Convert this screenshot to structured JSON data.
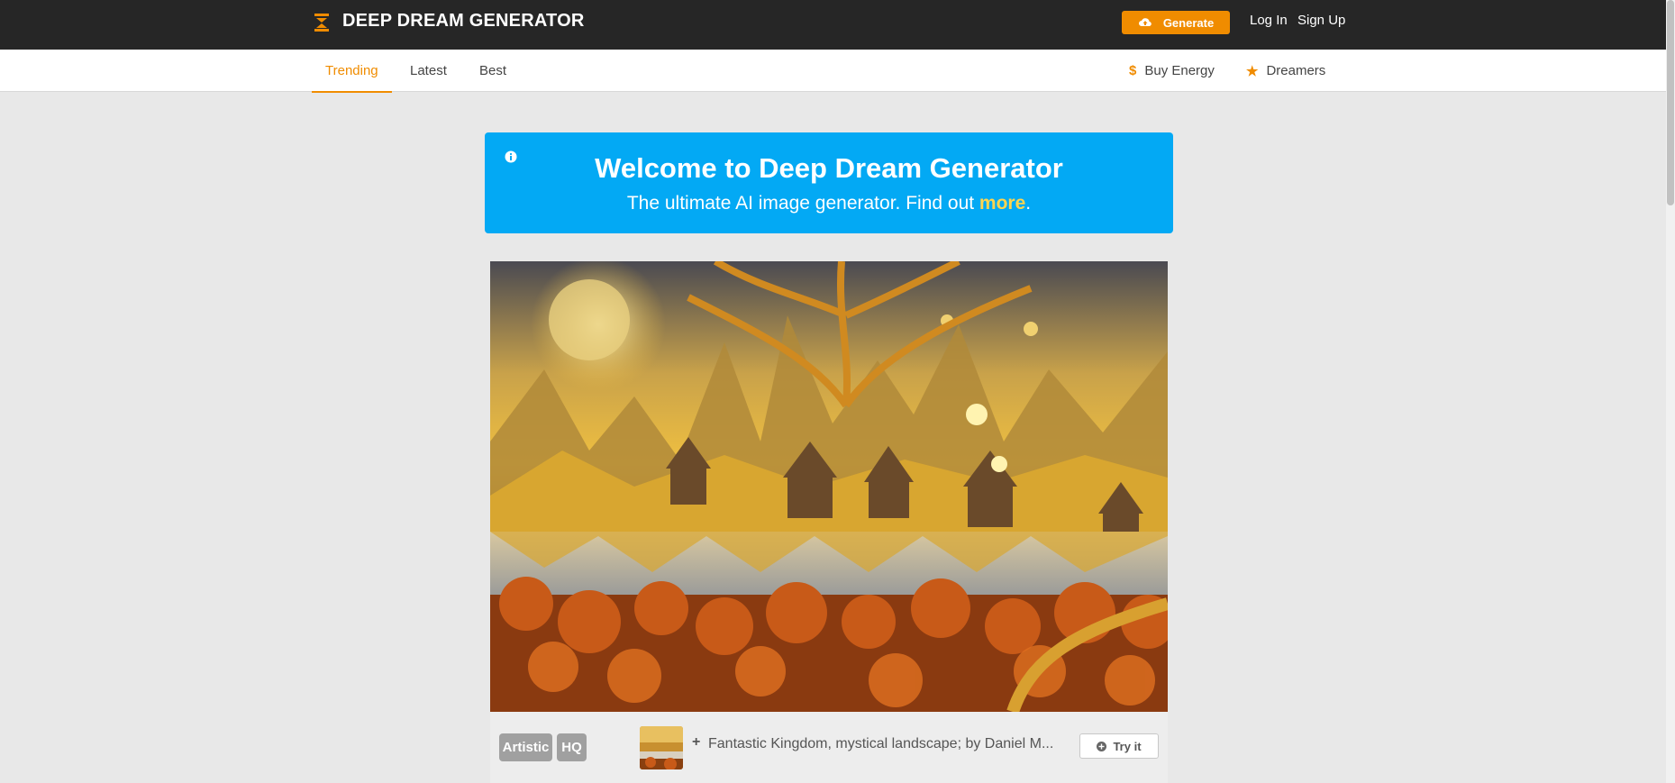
{
  "header": {
    "logo_text": "DEEP DREAM GENERATOR",
    "logo_icon": "hourglass-logo-icon",
    "generate_label": "Generate",
    "generate_icon": "cloud-upload-icon",
    "login_label": "Log In",
    "signup_label": "Sign Up",
    "accent_color": "#f08c00"
  },
  "subnav": {
    "tabs": [
      {
        "label": "Trending",
        "active": true
      },
      {
        "label": "Latest",
        "active": false
      },
      {
        "label": "Best",
        "active": false
      }
    ],
    "buy_energy": {
      "icon": "dollar-icon",
      "icon_glyph": "$",
      "label": "Buy Energy"
    },
    "dreamers": {
      "icon": "star-icon",
      "icon_glyph": "★",
      "label": "Dreamers"
    }
  },
  "welcome": {
    "icon": "info-icon",
    "title": "Welcome to Deep Dream Generator",
    "subtitle_prefix": "The ultimate AI image generator. Find out ",
    "subtitle_link": "more",
    "subtitle_suffix": ".",
    "background_color": "#03a9f4"
  },
  "feed": {
    "card": {
      "badges": [
        "Artistic",
        "HQ"
      ],
      "plus": "+",
      "prompt": "Fantastic Kingdom, mystical landscape; by Daniel M...",
      "try_label": "Try it",
      "try_icon": "plus-circle-icon"
    }
  }
}
